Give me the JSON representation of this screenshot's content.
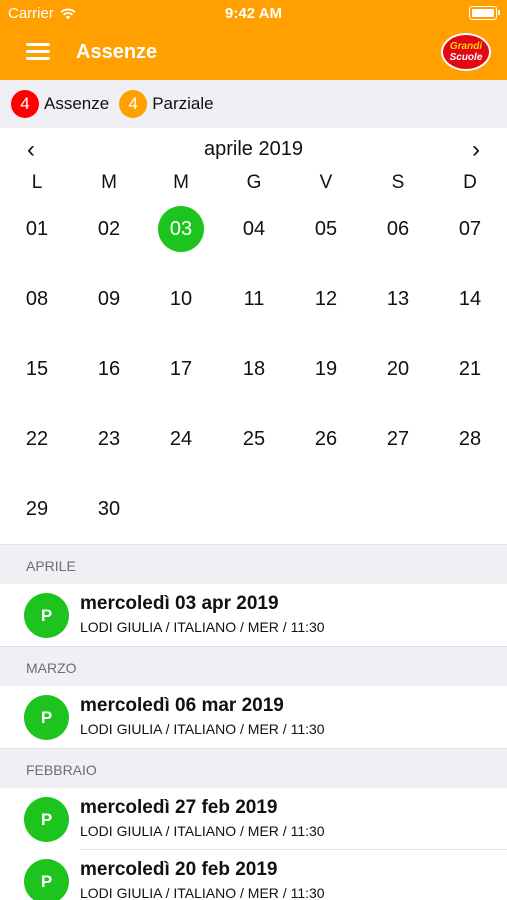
{
  "status_bar": {
    "carrier": "Carrier",
    "time": "9:42 AM",
    "wifi_icon": "wifi-icon",
    "battery_icon": "battery-icon"
  },
  "nav": {
    "title": "Assenze",
    "menu_icon": "hamburger-menu-icon",
    "logo_line1": "Grandi",
    "logo_line2": "Scuole"
  },
  "colors": {
    "accent": "#FF9F00",
    "absence_red": "#FF0000",
    "partial_orange": "#FF9F00",
    "present_green": "#1DC41D",
    "section_bg": "#EFEFF4"
  },
  "summary": [
    {
      "count": "4",
      "label": "Assenze",
      "color": "red"
    },
    {
      "count": "4",
      "label": "Parziale",
      "color": "orange"
    }
  ],
  "calendar": {
    "month_label": "aprile 2019",
    "prev_label": "‹",
    "next_label": "›",
    "weekdays": [
      "L",
      "M",
      "M",
      "G",
      "V",
      "S",
      "D"
    ],
    "selected_day": "03",
    "weeks": [
      [
        "01",
        "02",
        "03",
        "04",
        "05",
        "06",
        "07"
      ],
      [
        "08",
        "09",
        "10",
        "11",
        "12",
        "13",
        "14"
      ],
      [
        "15",
        "16",
        "17",
        "18",
        "19",
        "20",
        "21"
      ],
      [
        "22",
        "23",
        "24",
        "25",
        "26",
        "27",
        "28"
      ],
      [
        "29",
        "30",
        "",
        "",
        "",
        "",
        ""
      ]
    ]
  },
  "sections": [
    {
      "header": "APRILE",
      "items": [
        {
          "badge": "P",
          "date": "mercoledì 03 apr 2019",
          "detail": "LODI GIULIA / ITALIANO / MER / 11:30"
        }
      ]
    },
    {
      "header": "MARZO",
      "items": [
        {
          "badge": "P",
          "date": "mercoledì 06 mar 2019",
          "detail": "LODI GIULIA / ITALIANO / MER / 11:30"
        }
      ]
    },
    {
      "header": "FEBBRAIO",
      "items": [
        {
          "badge": "P",
          "date": "mercoledì 27 feb 2019",
          "detail": "LODI GIULIA / ITALIANO / MER / 11:30"
        },
        {
          "badge": "P",
          "date": "mercoledì 20 feb 2019",
          "detail": "LODI GIULIA / ITALIANO / MER / 11:30"
        }
      ]
    }
  ]
}
